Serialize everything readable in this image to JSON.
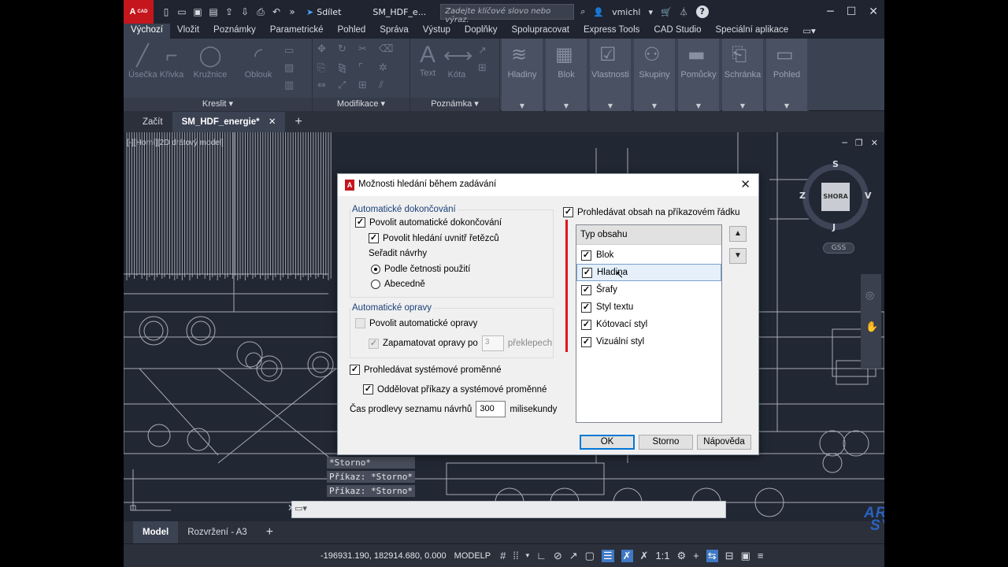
{
  "titlebar": {
    "logo": "A",
    "logo_sub": "CAD",
    "share_label": "Sdílet",
    "doc_name": "SM_HDF_e...",
    "search_placeholder": "Zadejte klíčové slovo nebo výraz.",
    "user": "vmichl"
  },
  "ribbon_tabs": [
    "Výchozí",
    "Vložit",
    "Poznámky",
    "Parametrické",
    "Pohled",
    "Správa",
    "Výstup",
    "Doplňky",
    "Spolupracovat",
    "Express Tools",
    "CAD Studio",
    "Speciální aplikace"
  ],
  "ribbon": {
    "draw": {
      "title": "Kreslit",
      "tools": [
        "Úsečka",
        "Křivka",
        "Kružnice",
        "Oblouk"
      ]
    },
    "modify": {
      "title": "Modifikace"
    },
    "annotation": {
      "title": "Poznámka",
      "tools": [
        "Text",
        "Kóta"
      ]
    },
    "groups": [
      "Hladiny",
      "Blok",
      "Vlastnosti",
      "Skupiny",
      "Pomůcky",
      "Schránka",
      "Pohled"
    ]
  },
  "doc_tabs": {
    "start": "Začít",
    "active": "SM_HDF_energie*"
  },
  "viewport": {
    "label": "[-][Horní][2D drátový model]",
    "viewcube": {
      "face": "SHORA",
      "n": "S",
      "e": "V",
      "s": "J",
      "w": "Z"
    },
    "gss": "GSS"
  },
  "command_history": [
    "*Storno*",
    "Příkaz: *Storno*",
    "Příkaz: *Storno*"
  ],
  "layout_tabs": [
    "Model",
    "Rozvržení - A3"
  ],
  "statusbar": {
    "coords": "-196931.190, 182914.680, 0.000",
    "space": "MODELP",
    "scale": "1:1"
  },
  "watermark": {
    "line1": "ARKANCE",
    "line2": "SYSTEMS"
  },
  "dialog": {
    "title": "Možnosti hledání během zadávání",
    "autocomplete_group": "Automatické dokončování",
    "allow_autocomplete": "Povolit automatické dokončování",
    "allow_midstring": "Povolit hledání uvnitř řetězců",
    "sort_label": "Seřadit návrhy",
    "sort_frequency": "Podle četnosti použití",
    "sort_alpha": "Abecedně",
    "autocorrect_group": "Automatické opravy",
    "allow_autocorrect": "Povolit automatické opravy",
    "remember_after": "Zapamatovat opravy po",
    "remember_value": "3",
    "remember_unit": "překlepech",
    "search_sysvars": "Prohledávat systémové proměnné",
    "separate_cmds": "Oddělovat příkazy a systémové proměnné",
    "delay_label": "Čas prodlevy seznamu návrhů",
    "delay_value": "300",
    "delay_unit": "milisekundy",
    "search_content": "Prohledávat obsah na příkazovém řádku",
    "list_header": "Typ obsahu",
    "content_types": [
      "Blok",
      "Hladina",
      "Šrafy",
      "Styl textu",
      "Kótovací styl",
      "Vizuální styl"
    ],
    "ok": "OK",
    "cancel": "Storno",
    "help": "Nápověda"
  }
}
